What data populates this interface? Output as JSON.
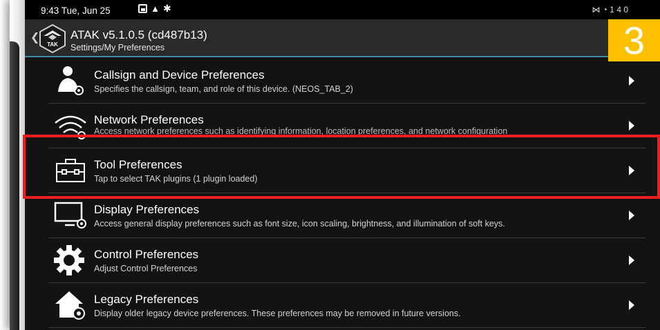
{
  "status_bar": {
    "time": "9:43",
    "date": "Tue, Jun 25",
    "icons": [
      "gallery-icon",
      "notification-icon",
      "settings-icon"
    ],
    "right": "⋈ ◔ 1 4 0"
  },
  "app_bar": {
    "title": "ATAK v5.1.0.5 (cd487b13)",
    "subtitle": "Settings/My Preferences",
    "logo_text": "TAK"
  },
  "step_badge": {
    "number": "3",
    "color": "#ffc000"
  },
  "preferences": [
    {
      "title": "Callsign and Device Preferences",
      "description": "Specifies the callsign, team, and role of this device. (NEOS_TAB_2)",
      "icon": "person-gear-icon"
    },
    {
      "title": "Network Preferences",
      "description": "Access network preferences such as identifying information, location preferences, and network configuration",
      "icon": "wifi-gear-icon"
    },
    {
      "title": "Tool Preferences",
      "description": "Tap to select TAK plugins (1 plugin loaded)",
      "icon": "toolbox-icon"
    },
    {
      "title": "Display Preferences",
      "description": "Access general display preferences such as font size, icon scaling, brightness, and illumination of soft keys.",
      "icon": "monitor-gear-icon"
    },
    {
      "title": "Control Preferences",
      "description": "Adjust Control Preferences",
      "icon": "gear-icon"
    },
    {
      "title": "Legacy Preferences",
      "description": "Display older legacy device preferences. These preferences may be removed in future versions.",
      "icon": "house-gear-icon"
    }
  ],
  "highlight_color": "#ee1c1c",
  "accent_color": "#3d8ea8"
}
